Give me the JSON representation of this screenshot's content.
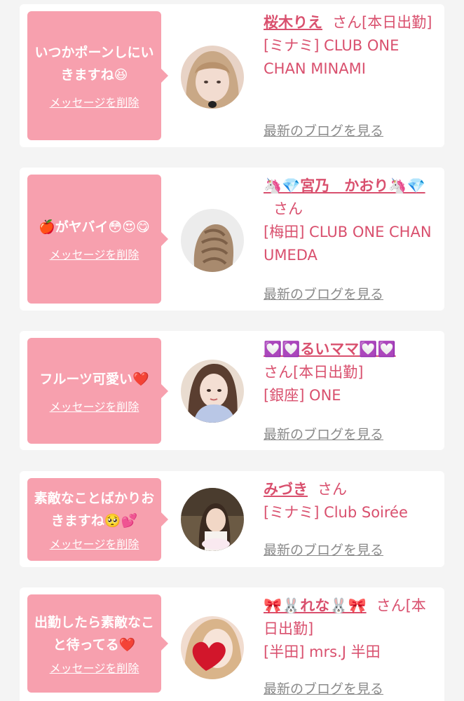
{
  "delete_label": "メッセージを削除",
  "blog_label": "最新のブログを見る",
  "colors": {
    "bubble": "#f7a0ae",
    "name": "#d9506e",
    "link": "#8a8a8a"
  },
  "items": [
    {
      "message": "いつかポーンしにいきますね😆",
      "name": "桜木りえ",
      "suffix": "さん[本日出勤]",
      "shop": "[ミナミ] CLUB ONE CHAN MINAMI",
      "avatar": "avatar-woman-blonde-icon"
    },
    {
      "message": "🍎がヤバイ😳😍😋",
      "name": "🦄💎宮乃　かおり🦄💎",
      "suffix": "さん",
      "shop": "[梅田] CLUB ONE CHAN UMEDA",
      "avatar": "avatar-braided-hair-icon"
    },
    {
      "message": "フルーツ可愛い❤️",
      "name": "💟💟るいママ💟💟",
      "suffix": "さん[本日出勤]",
      "shop": "[銀座] ONE",
      "avatar": "avatar-woman-kimono-icon"
    },
    {
      "message": "素敵なことばかりおきますね🥺💕",
      "name": "みづき",
      "suffix": "さん",
      "shop": "[ミナミ] Club Soirée",
      "avatar": "avatar-woman-cake-icon"
    },
    {
      "message": "出勤したら素敵なこと待ってる❤️",
      "name": "🎀🐰れな🐰🎀",
      "suffix": "さん[本日出勤]",
      "shop": "[半田] mrs.J 半田",
      "avatar": "avatar-heart-icon"
    }
  ]
}
